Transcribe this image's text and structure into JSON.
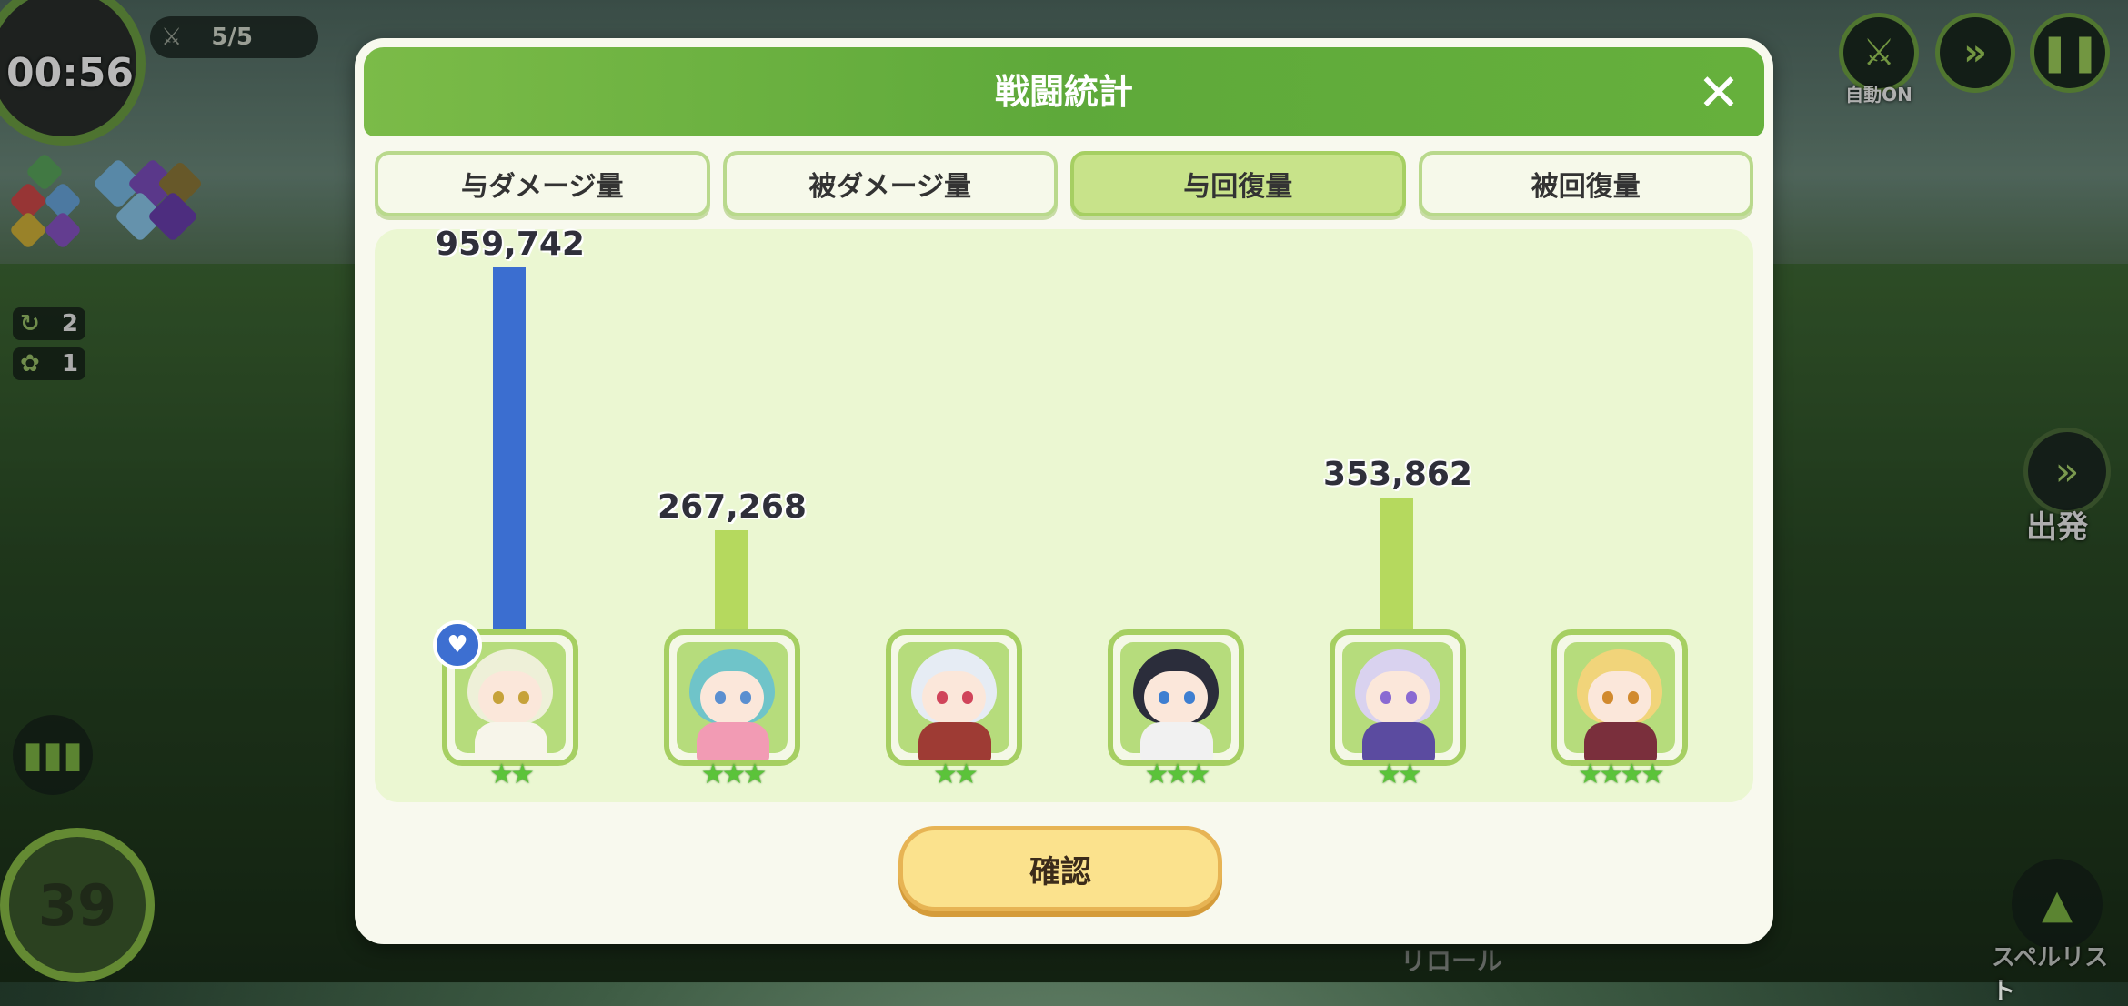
{
  "hud": {
    "timer": "00:56",
    "wave": "5/5",
    "counter_a": "2",
    "counter_b": "1",
    "auto_label": "自動ON",
    "depart_label": "出発",
    "level": "39",
    "reroll_label": "リロール",
    "spell_list_label": "スペルリスト"
  },
  "modal": {
    "title": "戦闘統計",
    "tabs": [
      {
        "label": "与ダメージ量",
        "active": false
      },
      {
        "label": "被ダメージ量",
        "active": false
      },
      {
        "label": "与回復量",
        "active": true
      },
      {
        "label": "被回復量",
        "active": false
      }
    ],
    "confirm_label": "確認"
  },
  "colors": {
    "top_bar": "#3b6ed0",
    "bar": "#b5d95e",
    "accent_green": "#66b03c",
    "confirm_bg": "#fbe28d"
  },
  "chart_data": {
    "type": "bar",
    "categories": [
      "unit-1",
      "unit-2",
      "unit-3",
      "unit-4",
      "unit-5",
      "unit-6"
    ],
    "values": [
      959742,
      267268,
      0,
      0,
      353862,
      0
    ],
    "labels": [
      "959,742",
      "267,268",
      "",
      "",
      "353,862",
      ""
    ],
    "stars": [
      2,
      3,
      2,
      3,
      2,
      4
    ],
    "top_index": 0,
    "ylim": [
      0,
      959742
    ]
  }
}
